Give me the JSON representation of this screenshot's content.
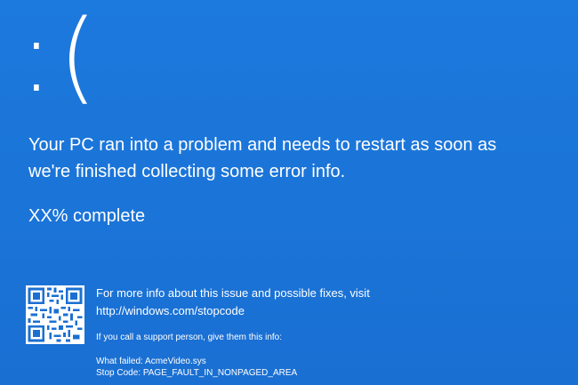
{
  "screen": {
    "face": ":(",
    "headline_line1": "Your PC ran into a problem and needs to restart as soon as",
    "headline_line2": "we're finished collecting some error info.",
    "progress": "XX% complete",
    "more_info_line1": "For more info about this issue and possible fixes, visit",
    "more_info_link": "http://windows.com/stopcode",
    "support_line": "If you call a support person, give them this info:",
    "what_failed": "What failed: AcmeVideo.sys",
    "stop_code": "Stop Code: PAGE_FAULT_IN_NONPAGED_AREA"
  },
  "colors": {
    "background": "#1a73d6",
    "text": "#ffffff"
  },
  "icons": {
    "qr": "qr-code-icon"
  }
}
